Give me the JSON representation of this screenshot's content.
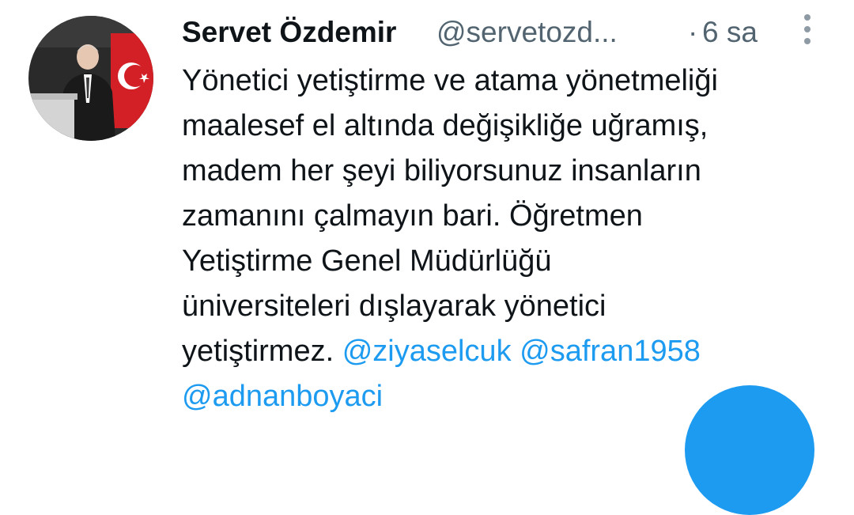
{
  "tweet": {
    "display_name": "Servet Özdemir",
    "handle": "@servetozd...",
    "dot": "·",
    "time": "6 sa",
    "more_icon": "more-vertical-icon",
    "text_lines": [
      "Yönetici yetiştirme ve atama yönetmeliği",
      "maalesef el altında değişikliğe uğramış,",
      "madem her şeyi biliyorsunuz insanların",
      "zamanını çalmayın bari. Öğretmen",
      "Yetiştirme Genel Müdürlüğü",
      "üniversiteleri dışlayarak yönetici"
    ],
    "last_line_text": "yetiştirmez.",
    "mentions": [
      "@ziyaselcuk",
      "@safran1958",
      "@adnanboyaci"
    ]
  },
  "colors": {
    "text": "#0f1419",
    "secondary": "#536471",
    "accent": "#1d9bf0"
  },
  "fab": {
    "icon": "compose-icon"
  }
}
